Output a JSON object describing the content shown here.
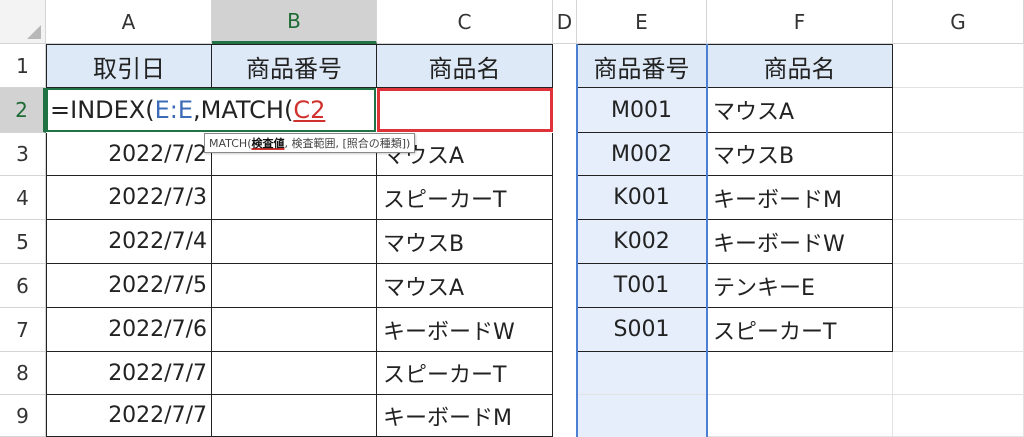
{
  "columns": [
    "A",
    "B",
    "C",
    "D",
    "E",
    "F",
    "G"
  ],
  "rows": [
    "1",
    "2",
    "3",
    "4",
    "5",
    "6",
    "7",
    "8",
    "9"
  ],
  "left_table": {
    "headers": [
      "取引日",
      "商品番号",
      "商品名"
    ],
    "rows": [
      [
        "",
        "",
        ""
      ],
      [
        "2022/7/2",
        "",
        "マウスA"
      ],
      [
        "2022/7/3",
        "",
        "スピーカーT"
      ],
      [
        "2022/7/4",
        "",
        "マウスB"
      ],
      [
        "2022/7/5",
        "",
        "マウスA"
      ],
      [
        "2022/7/6",
        "",
        "キーボードW"
      ],
      [
        "2022/7/7",
        "",
        "スピーカーT"
      ],
      [
        "2022/7/7",
        "",
        "キーボードM"
      ]
    ]
  },
  "right_table": {
    "headers": [
      "商品番号",
      "商品名"
    ],
    "rows": [
      [
        "M001",
        "マウスA"
      ],
      [
        "M002",
        "マウスB"
      ],
      [
        "K001",
        "キーボードM"
      ],
      [
        "K002",
        "キーボードW"
      ],
      [
        "T001",
        "テンキーE"
      ],
      [
        "S001",
        "スピーカーT"
      ]
    ]
  },
  "formula": {
    "part1": "=INDEX(",
    "part2": "E:E",
    "part3": ",MATCH(",
    "part4": "C2"
  },
  "tooltip": {
    "prefix": "MATCH(",
    "current": "検査値",
    "rest": ", 検査範囲, [照合の種類])"
  }
}
